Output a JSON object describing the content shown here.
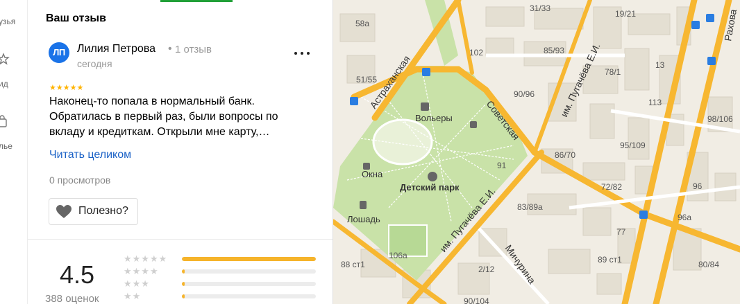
{
  "rail": {
    "items": [
      {
        "label": "узья"
      },
      {
        "label": "ид"
      },
      {
        "label": "лье"
      }
    ]
  },
  "review": {
    "heading": "Ваш отзыв",
    "avatar_initials": "ЛП",
    "author": "Лилия Петрова",
    "separator": "•",
    "author_reviews": "1 отзыв",
    "date": "сегодня",
    "rating_stars": 5,
    "stars_glyph": "★★★★★",
    "text": "Наконец-то попала в нормальный банк. Обратилась в первый раз, были вопросы по вкладу и кредиткам. Открыли мне карту,…",
    "read_more": "Читать целиком",
    "views": "0 просмотров",
    "useful_label": "Полезно?"
  },
  "summary": {
    "rating": "4.5",
    "count": "388 оценок",
    "distribution": [
      {
        "stars": "★★★★★",
        "fraction": 1.0
      },
      {
        "stars": "★★★★",
        "fraction": 0.02
      },
      {
        "stars": "★★★",
        "fraction": 0.02
      },
      {
        "stars": "★★",
        "fraction": 0.02
      }
    ]
  },
  "colors": {
    "accent": "#21a038",
    "link": "#1a61c6",
    "star": "#f6b42b",
    "avatar": "#1a73e8",
    "road_major": "#f7b731",
    "park": "#c9e2a8"
  },
  "map": {
    "labels": {
      "astrakhanskaya": "Астраханская",
      "sovetskaya": "Советская",
      "pugacheva1": "им. Пугачёва Е.И.",
      "pugacheva2": "им. Пугачёва Е.И.",
      "michurina": "Мичурина",
      "rakhova": "Рахова",
      "volery": "Вольеры",
      "okna": "Окна",
      "detskiy_park": "Детский парк",
      "loshad": "Лошадь"
    },
    "house_numbers": {
      "n31_33": "31/33",
      "n19_21": "19/21",
      "n58a": "58а",
      "n102": "102",
      "n85_93": "85/93",
      "n78_1": "78/1",
      "n13": "13",
      "n51_55": "51/55",
      "n90_96": "90/96",
      "n113": "113",
      "n98_106": "98/106",
      "n95_109": "95/109",
      "n86_70": "86/70",
      "n91": "91",
      "n72_82": "72/82",
      "n96": "96",
      "n83_89a": "83/89а",
      "n96a": "96а",
      "n77": "77",
      "n106a": "106а",
      "n88_st1": "88 ст1",
      "n89_st1": "89 ст1",
      "n80_84": "80/84",
      "n2_12": "2/12",
      "n90_104": "90/104"
    }
  }
}
